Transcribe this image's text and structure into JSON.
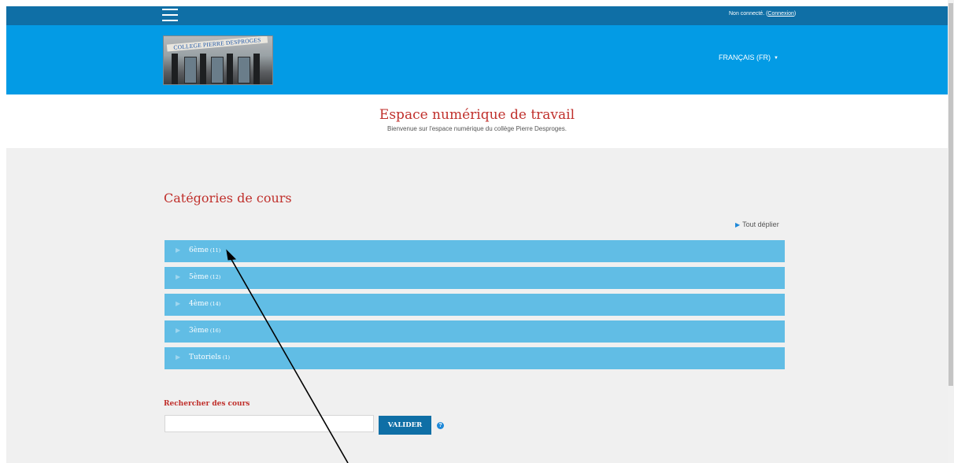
{
  "navbar": {
    "login_prefix": "Non connecté. (",
    "login_link": "Connexion",
    "login_suffix": ")"
  },
  "header": {
    "logo_text": "COLLEGE PIERRE DESPROGES",
    "language": "FRANÇAIS (FR)"
  },
  "site": {
    "title": "Espace numérique de travail",
    "subtitle": "Bienvenue sur l'espace numérique du collège Pierre Desproges."
  },
  "main": {
    "categories_title": "Catégories de cours",
    "expand_all": "Tout déplier",
    "categories": [
      {
        "name": "6ème",
        "count": "(11)"
      },
      {
        "name": "5ème",
        "count": "(12)"
      },
      {
        "name": "4ème",
        "count": "(14)"
      },
      {
        "name": "3ème",
        "count": "(16)"
      },
      {
        "name": "Tutoriels",
        "count": "(1)"
      }
    ],
    "search_label": "Rechercher des cours",
    "search_value": "",
    "search_button": "VALIDER",
    "help_glyph": "?"
  },
  "colors": {
    "navbar": "#0f6fa6",
    "header": "#039be5",
    "category_bar": "#61bde5",
    "title_red": "#c0302c",
    "button": "#0f6fa6"
  },
  "icons": {
    "menu": "hamburger-icon",
    "caret": "caret-down-icon",
    "expand": "triangle-right-icon",
    "help": "question-circle-icon"
  }
}
